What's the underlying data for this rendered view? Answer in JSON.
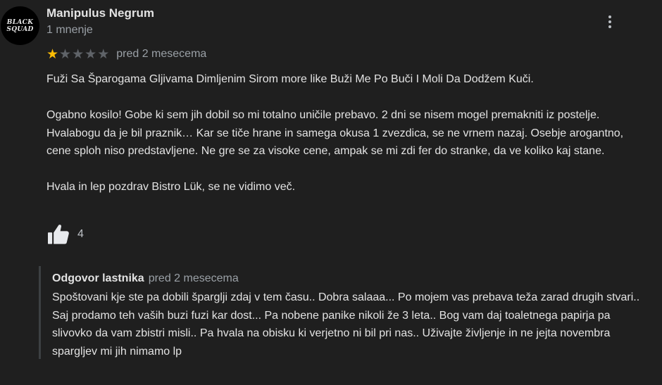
{
  "review": {
    "author": {
      "name": "Manipulus Negrum",
      "review_count": "1 mnenje",
      "avatar_text_line1": "BLACK",
      "avatar_text_line2": "SQUAD"
    },
    "rating": 1,
    "rating_max": 5,
    "date": "pred 2 mesecema",
    "paragraphs": [
      "Fuži Sa Šparogama Gljivama Dimljenim Sirom more like Buži Me Po Buči I Moli Da Dodžem Kuči.",
      "Ogabno kosilo! Gobe ki sem jih dobil so mi totalno uničile prebavo. 2 dni se nisem mogel premakniti iz postelje. Hvalabogu da je bil praznik… Kar se tiče hrane in samega okusa 1 zvezdica, se ne vrnem nazaj. Osebje arogantno, cene sploh niso predstavljene. Ne gre se za visoke cene, ampak se mi zdi fer do stranke, da ve koliko kaj stane.",
      "Hvala in lep pozdrav Bistro Lük, se ne vidimo več."
    ],
    "likes": "4",
    "icons": {
      "like": "thumbs-up-icon",
      "more": "more-vert-icon",
      "star": "star-icon"
    },
    "colors": {
      "background": "#1f1f1f",
      "star_filled": "#fbbc04",
      "star_empty": "#5f6368",
      "secondary_text": "#9aa0a6"
    }
  },
  "owner_reply": {
    "label": "Odgovor lastnika",
    "date": "pred 2 mesecema",
    "text": "Spoštovani kje ste pa dobili šparglji zdaj v tem času.. Dobra salaaa... Po mojem vas prebava teža zarad drugih stvari.. Saj prodamo teh vaših buzi fuzi kar dost... Pa nobene panike nikoli že 3 leta.. Bog vam daj toaletnega papirja pa slivovko da vam zbistri misli.. Pa hvala na obisku ki verjetno ni bil pri nas.. Uživajte življenje in ne jejta novembra spargljev mi jih nimamo lp"
  }
}
